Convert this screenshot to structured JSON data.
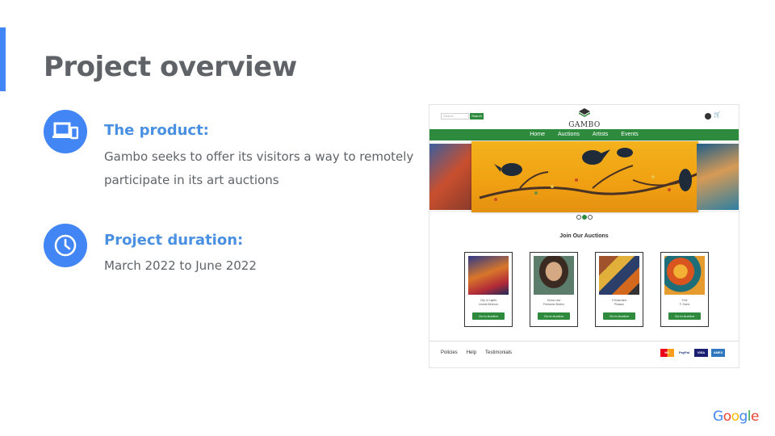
{
  "slide": {
    "title": "Project overview",
    "product": {
      "heading": "The product:",
      "text": "Gambo seeks to offer its visitors a way to remotely participate in its art auctions",
      "icon": "devices-icon"
    },
    "duration": {
      "heading": "Project duration:",
      "text": "March 2022 to June 2022",
      "icon": "clock-icon"
    },
    "google_logo": [
      "G",
      "o",
      "o",
      "g",
      "l",
      "e"
    ],
    "colors": {
      "accent": "#4285f4",
      "heading": "#4a90e2",
      "body": "#5f6368"
    }
  },
  "mockup": {
    "search_placeholder": "Search",
    "search_button": "Search",
    "logo": "GAMBO",
    "nav": [
      "Home",
      "Auctions",
      "Artists",
      "Events"
    ],
    "section_title": "Join Our Auctions",
    "cards": [
      {
        "title": "City of Lights",
        "artist": "Leonid Afremov",
        "button": "Go to Auction"
      },
      {
        "title": "Mona Lisa",
        "artist": "Fernando Botero",
        "button": "Go to Auction"
      },
      {
        "title": "3 Musicians",
        "artist": "Picasso",
        "button": "Go to Auction"
      },
      {
        "title": "Tree",
        "artist": "F. Davis",
        "button": "Go to Auction"
      }
    ],
    "footer": [
      "Policies",
      "Help",
      "Testimonials"
    ],
    "payments": [
      "MC",
      "PayPal",
      "VISA",
      "AMEX"
    ],
    "brand_color": "#2e8b3e"
  }
}
